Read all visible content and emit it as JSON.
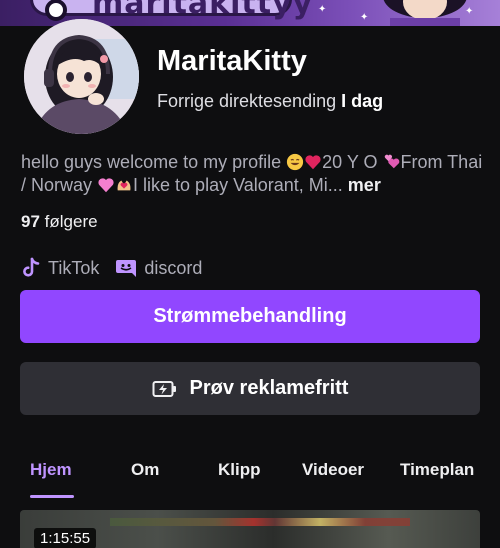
{
  "banner": {
    "title": "maritakittyy"
  },
  "profile": {
    "username": "MaritaKitty",
    "last_live_prefix": "Forrige direktesending",
    "last_live_when": "I dag",
    "bio_part1": "hello guys welcome to my profile ",
    "bio_part2": "20 Y O ",
    "bio_part3": "From Thai / Norway ",
    "bio_part4": "I like to play Valorant, Mi...",
    "bio_more": " mer",
    "followers_count": "97",
    "followers_label": " følgere"
  },
  "socials": [
    {
      "label": "TikTok",
      "icon": "tiktok-icon"
    },
    {
      "label": "discord",
      "icon": "discord-icon"
    }
  ],
  "buttons": {
    "primary_label": "Strømmebehandling",
    "secondary_label": "Prøv reklamefritt"
  },
  "tabs": [
    {
      "label": "Hjem",
      "active": true
    },
    {
      "label": "Om"
    },
    {
      "label": "Klipp"
    },
    {
      "label": "Videoer"
    },
    {
      "label": "Timeplan"
    }
  ],
  "video": {
    "duration": "1:15:55"
  },
  "colors": {
    "accent": "#9147ff",
    "accent_light": "#bf94ff",
    "background": "#0e0e10",
    "secondary_button": "#2f2f35"
  }
}
